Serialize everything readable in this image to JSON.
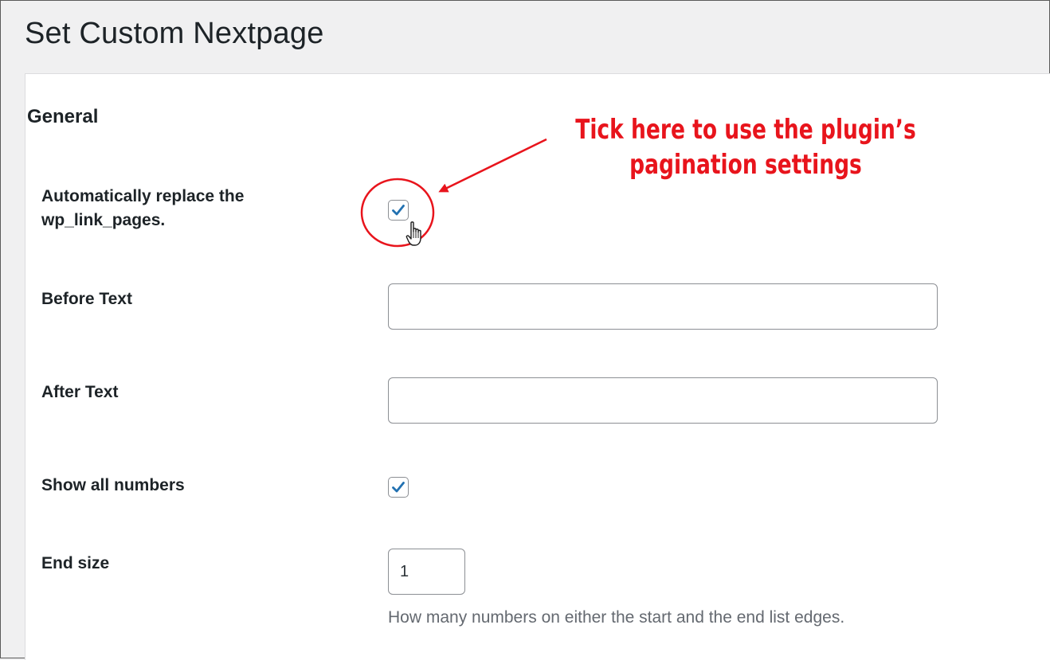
{
  "page": {
    "title": "Set Custom Nextpage"
  },
  "section": {
    "heading": "General"
  },
  "rows": {
    "auto_replace": {
      "label": "Automatically replace the wp_link_pages.",
      "checked": true
    },
    "before_text": {
      "label": "Before Text",
      "value": ""
    },
    "after_text": {
      "label": "After Text",
      "value": ""
    },
    "show_all_numbers": {
      "label": "Show all numbers",
      "checked": true
    },
    "end_size": {
      "label": "End size",
      "value": "1",
      "description": "How many numbers on either the start and the end list edges."
    }
  },
  "annotation": {
    "text": "Tick here to use the plugin’s pagination settings",
    "color": "#e8141c"
  },
  "colors": {
    "check_mark": "#2271b1",
    "panel_background": "#ffffff",
    "page_background": "#f0f0f1"
  },
  "icons": {
    "checkbox_check": "check-icon",
    "pointer": "hand-pointer-icon"
  }
}
